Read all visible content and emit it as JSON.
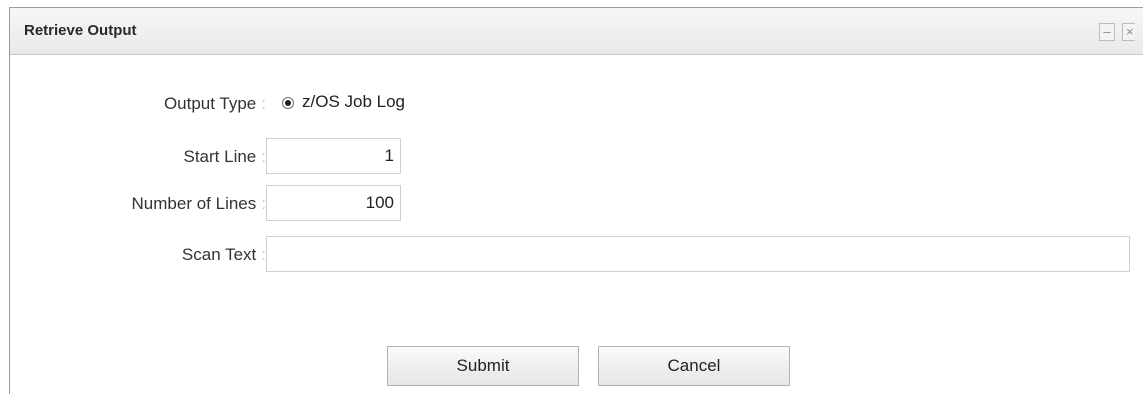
{
  "dialog": {
    "title": "Retrieve Output",
    "minimize_glyph": "–",
    "close_glyph": "×"
  },
  "form": {
    "output_type": {
      "label": "Output Type",
      "option_label": "z/OS Job Log",
      "selected": true
    },
    "start_line": {
      "label": "Start Line",
      "value": "1"
    },
    "number_of_lines": {
      "label": "Number of Lines",
      "value": "100"
    },
    "scan_text": {
      "label": "Scan Text",
      "value": ""
    },
    "colon": ":"
  },
  "buttons": {
    "submit": "Submit",
    "cancel": "Cancel"
  }
}
